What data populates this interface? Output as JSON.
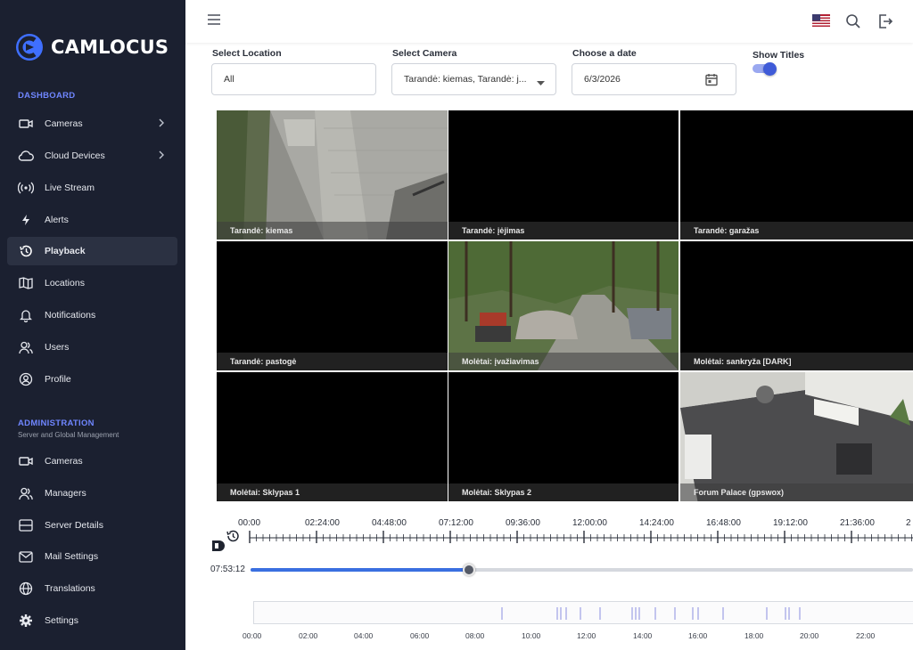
{
  "app": {
    "name": "CAMLOCUS"
  },
  "sidebar": {
    "dashboard_title": "DASHBOARD",
    "dashboard_items": [
      {
        "label": "Cameras",
        "icon": "video-camera-icon",
        "has_submenu": true
      },
      {
        "label": "Cloud Devices",
        "icon": "cloud-icon",
        "has_submenu": true
      },
      {
        "label": "Live Stream",
        "icon": "broadcast-icon",
        "has_submenu": false
      },
      {
        "label": "Alerts",
        "icon": "lightning-icon",
        "has_submenu": false
      },
      {
        "label": "Playback",
        "icon": "history-icon",
        "has_submenu": false,
        "active": true
      },
      {
        "label": "Locations",
        "icon": "map-icon",
        "has_submenu": false
      },
      {
        "label": "Notifications",
        "icon": "bell-icon",
        "has_submenu": false
      },
      {
        "label": "Users",
        "icon": "users-icon",
        "has_submenu": false
      },
      {
        "label": "Profile",
        "icon": "user-circle-icon",
        "has_submenu": false
      }
    ],
    "admin_title": "ADMINISTRATION",
    "admin_subtitle": "Server and Global Management",
    "admin_items": [
      {
        "label": "Cameras",
        "icon": "video-camera-icon"
      },
      {
        "label": "Managers",
        "icon": "users-icon"
      },
      {
        "label": "Server Details",
        "icon": "server-icon"
      },
      {
        "label": "Mail Settings",
        "icon": "mail-icon"
      },
      {
        "label": "Translations",
        "icon": "globe-icon"
      },
      {
        "label": "Settings",
        "icon": "gear-icon"
      }
    ]
  },
  "filters": {
    "location_label": "Select Location",
    "location_value": "All",
    "camera_label": "Select Camera",
    "camera_value": "Tarandė: kiemas, Tarandė: j...",
    "date_label": "Choose a date",
    "date_value": "6/3/2026",
    "show_titles_label": "Show Titles",
    "show_titles_on": true
  },
  "cameras": [
    {
      "title": "Tarandė: kiemas",
      "has_feed": true
    },
    {
      "title": "Tarandė: įėjimas",
      "has_feed": false
    },
    {
      "title": "Tarandė: garažas",
      "has_feed": false
    },
    {
      "title": "Tarandė: pastogė",
      "has_feed": false
    },
    {
      "title": "Molėtai: įvažiavimas",
      "has_feed": true
    },
    {
      "title": "Molėtai: sankryža [DARK]",
      "has_feed": false
    },
    {
      "title": "Molėtai: Sklypas 1",
      "has_feed": false
    },
    {
      "title": "Molėtai: Sklypas 2",
      "has_feed": false
    },
    {
      "title": "Forum Palace (gpswox)",
      "has_feed": true
    }
  ],
  "timeline": {
    "ruler_labels": [
      "00:00",
      "02:24:00",
      "04:48:00",
      "07:12:00",
      "09:36:00",
      "12:00:00",
      "14:24:00",
      "16:48:00",
      "19:12:00",
      "21:36:00",
      "2"
    ],
    "current_time": "07:53:12",
    "progress_fraction": 0.33,
    "hour_labels": [
      "00:00",
      "02:00",
      "04:00",
      "06:00",
      "08:00",
      "10:00",
      "12:00",
      "14:00",
      "16:00",
      "18:00",
      "20:00",
      "22:00"
    ]
  },
  "colors": {
    "accent": "#3f5bd8",
    "sidebar_bg": "#1b2030"
  }
}
